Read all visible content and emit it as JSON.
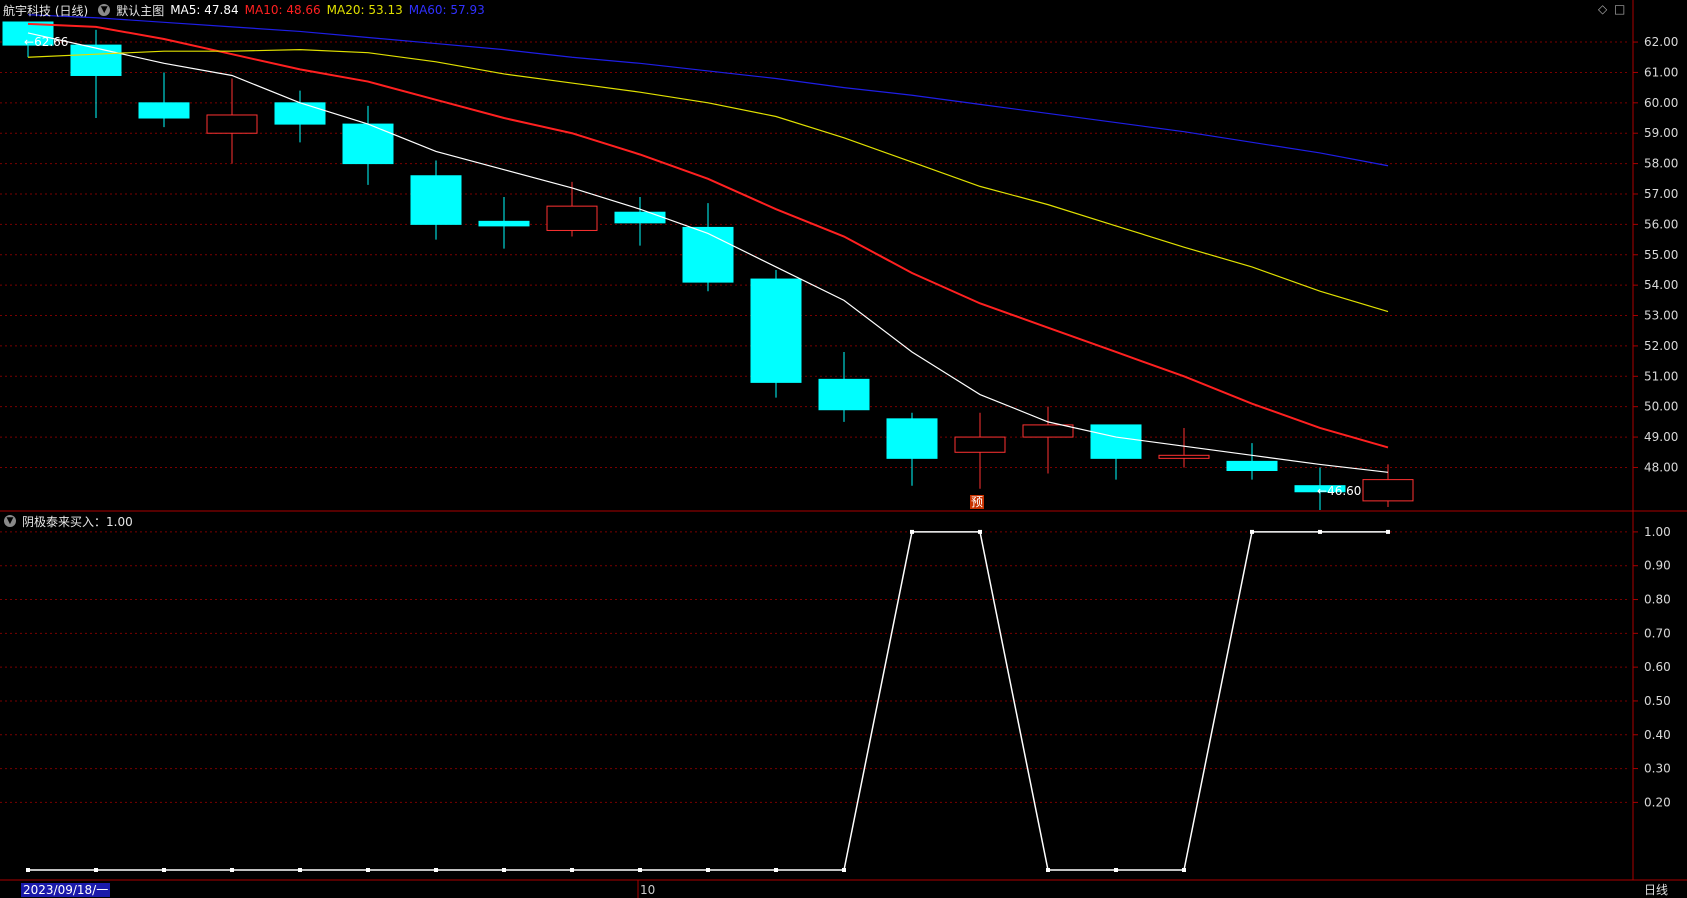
{
  "header": {
    "stock_name": "航宇科技 (日线)",
    "main_chart_label": "默认主图",
    "ma5": "MA5: 47.84",
    "ma10": "MA10: 48.66",
    "ma20": "MA20: 53.13",
    "ma60": "MA60: 57.93"
  },
  "indicator": {
    "label": "阴极泰来买入：1.00"
  },
  "annotations": {
    "high_label": "62.66",
    "low_label": "46.60",
    "yu_marker": "预"
  },
  "bottom": {
    "date_label": "2023/09/18/一",
    "month_label": "10",
    "period_label": "日线"
  },
  "colors": {
    "up": "#ff3232",
    "down": "#00ffff",
    "ma5": "#ffffff",
    "ma10": "#ff2020",
    "ma20": "#e0e000",
    "ma60": "#1e1ee6",
    "grid": "#7a0000",
    "axis": "#aa0000"
  },
  "chart_data": [
    {
      "type": "candlestick",
      "title": "航宇科技 (日线)",
      "ylim": [
        46.6,
        62.66
      ],
      "yticks": [
        48.0,
        49.0,
        50.0,
        51.0,
        52.0,
        53.0,
        54.0,
        55.0,
        56.0,
        57.0,
        58.0,
        59.0,
        60.0,
        61.0,
        62.0
      ],
      "candles": [
        {
          "open": 62.66,
          "close": 61.9,
          "high": 62.66,
          "low": 61.5
        },
        {
          "open": 61.9,
          "close": 60.9,
          "high": 62.4,
          "low": 59.5
        },
        {
          "open": 60.0,
          "close": 59.5,
          "high": 61.0,
          "low": 59.2
        },
        {
          "open": 59.0,
          "close": 59.6,
          "high": 60.8,
          "low": 58.0
        },
        {
          "open": 60.0,
          "close": 59.3,
          "high": 60.4,
          "low": 58.7
        },
        {
          "open": 59.3,
          "close": 58.0,
          "high": 59.9,
          "low": 57.3
        },
        {
          "open": 57.6,
          "close": 56.0,
          "high": 58.1,
          "low": 55.5
        },
        {
          "open": 56.1,
          "close": 55.95,
          "high": 56.9,
          "low": 55.2
        },
        {
          "open": 55.8,
          "close": 56.6,
          "high": 57.4,
          "low": 55.6
        },
        {
          "open": 56.4,
          "close": 56.05,
          "high": 56.9,
          "low": 55.3
        },
        {
          "open": 55.9,
          "close": 54.1,
          "high": 56.7,
          "low": 53.8
        },
        {
          "open": 54.2,
          "close": 50.8,
          "high": 54.5,
          "low": 50.3
        },
        {
          "open": 50.9,
          "close": 49.9,
          "high": 51.8,
          "low": 49.5
        },
        {
          "open": 49.6,
          "close": 48.3,
          "high": 49.8,
          "low": 47.4
        },
        {
          "open": 48.5,
          "close": 49.0,
          "high": 49.8,
          "low": 47.3
        },
        {
          "open": 49.0,
          "close": 49.4,
          "high": 50.0,
          "low": 47.8
        },
        {
          "open": 49.4,
          "close": 48.3,
          "high": 49.4,
          "low": 47.6
        },
        {
          "open": 48.3,
          "close": 48.4,
          "high": 49.3,
          "low": 48.0
        },
        {
          "open": 48.2,
          "close": 47.9,
          "high": 48.8,
          "low": 47.6
        },
        {
          "open": 47.4,
          "close": 47.2,
          "high": 48.0,
          "low": 46.6
        },
        {
          "open": 46.9,
          "close": 47.6,
          "high": 48.1,
          "low": 46.7
        }
      ],
      "series": [
        {
          "name": "MA5",
          "values": [
            62.3,
            61.8,
            61.3,
            60.9,
            60.0,
            59.3,
            58.4,
            57.8,
            57.2,
            56.5,
            55.7,
            54.6,
            53.5,
            51.8,
            50.4,
            49.5,
            49.0,
            48.7,
            48.4,
            48.1,
            47.84
          ]
        },
        {
          "name": "MA10",
          "values": [
            62.6,
            62.5,
            62.1,
            61.6,
            61.1,
            60.7,
            60.1,
            59.5,
            59.0,
            58.3,
            57.5,
            56.5,
            55.6,
            54.4,
            53.4,
            52.6,
            51.8,
            51.0,
            50.1,
            49.3,
            48.66
          ]
        },
        {
          "name": "MA20",
          "values": [
            61.5,
            61.6,
            61.7,
            61.7,
            61.75,
            61.65,
            61.35,
            60.95,
            60.65,
            60.35,
            60.0,
            59.55,
            58.85,
            58.05,
            57.25,
            56.65,
            55.95,
            55.25,
            54.6,
            53.8,
            53.13
          ]
        },
        {
          "name": "MA60",
          "values": [
            62.9,
            62.8,
            62.65,
            62.5,
            62.35,
            62.15,
            61.95,
            61.75,
            61.5,
            61.3,
            61.05,
            60.8,
            60.5,
            60.25,
            59.95,
            59.65,
            59.35,
            59.05,
            58.7,
            58.35,
            57.93
          ]
        }
      ]
    },
    {
      "type": "line",
      "title": "阴极泰来买入：1.00",
      "ylim": [
        0.0,
        1.05
      ],
      "yticks": [
        0.2,
        0.3,
        0.4,
        0.5,
        0.6,
        0.7,
        0.8,
        0.9,
        1.0
      ],
      "series": [
        {
          "name": "阴极泰来买入",
          "values": [
            0,
            0,
            0,
            0,
            0,
            0,
            0,
            0,
            0,
            0,
            0,
            0,
            0,
            1,
            1,
            0,
            0,
            0,
            1,
            1,
            1
          ]
        }
      ]
    }
  ]
}
